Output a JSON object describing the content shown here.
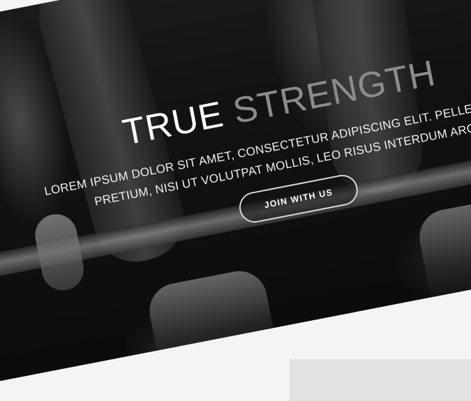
{
  "hero": {
    "title_primary": "TRUE",
    "title_accent": "STRENGTH",
    "lead_line1": "LOREM IPSUM DOLOR SIT AMET, CONSECTETUR ADIPISCING ELIT. PELLENTESQUE",
    "lead_line2": "PRETIUM, NISI UT VOLUTPAT MOLLIS, LEO RISUS INTERDUM ARCU.",
    "cta_label": "JOIN WITH US"
  },
  "colors": {
    "title_primary": "#ffffff",
    "title_accent": "#8c8c8c",
    "background": "#121212",
    "button_border": "#d8d8d8"
  }
}
